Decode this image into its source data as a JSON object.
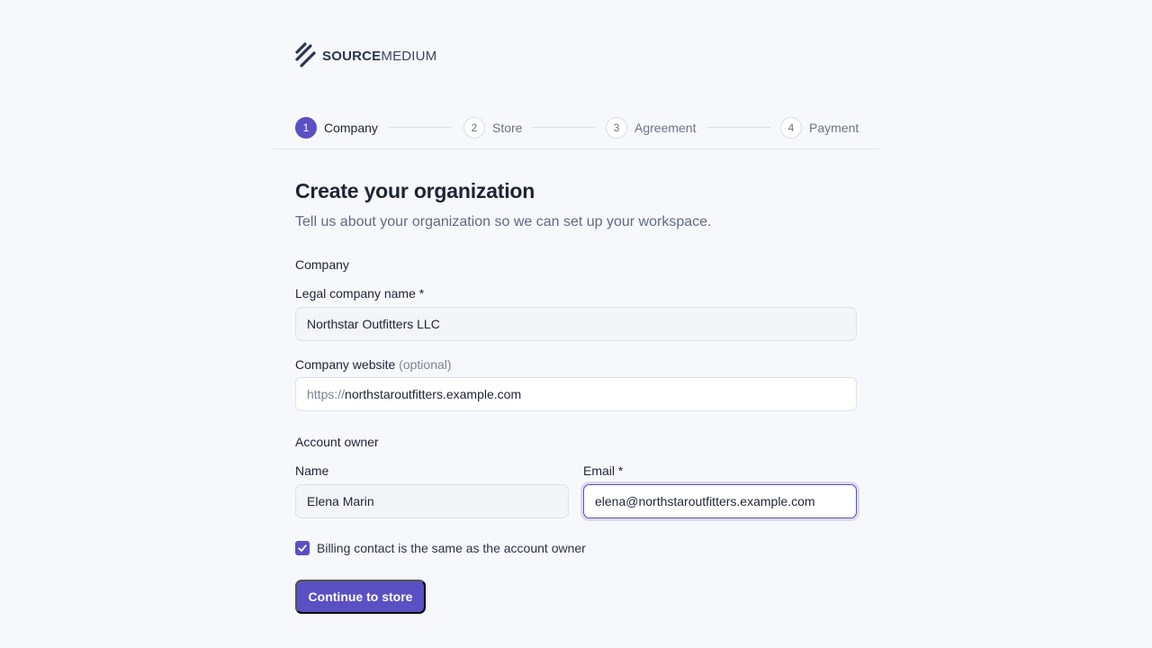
{
  "brand": {
    "name_strong": "SOURCE",
    "name_light": "MEDIUM",
    "accent_color": "#5b4fc4"
  },
  "stepper": {
    "steps": [
      {
        "number": "1",
        "label": "Company",
        "active": true
      },
      {
        "number": "2",
        "label": "Store",
        "active": false
      },
      {
        "number": "3",
        "label": "Agreement",
        "active": false
      },
      {
        "number": "4",
        "label": "Payment",
        "active": false
      }
    ]
  },
  "form": {
    "title": "Create your organization",
    "subtitle": "Tell us about your organization so we can set up your workspace.",
    "company_section": "Company",
    "legal_name_label": "Legal company name *",
    "legal_name_value": "Northstar Outfitters LLC",
    "website_label": "Company website",
    "website_hint": "(optional)",
    "website_prefix": "https://",
    "website_value": "northstaroutfitters.example.com",
    "owner_section": "Account owner",
    "name_label": "Name",
    "name_value": "Elena Marin",
    "email_label": "Email *",
    "email_value": "elena@northstaroutfitters.example.com",
    "billing_checkbox_label": "Billing contact is the same as the account owner",
    "billing_checked": true,
    "submit_label": "Continue to store"
  }
}
